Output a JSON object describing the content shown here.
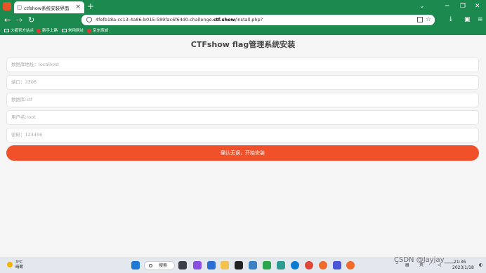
{
  "browser": {
    "tab_title": "ctfshow系统安装界面",
    "url_prefix": "4fefb18a-cc13-4a86-b015-589fac6f64d0.challenge.",
    "url_domain": "ctf.show",
    "url_path": "/install.php?",
    "bookmarks": [
      "火狐官方站点",
      "新手上路",
      "常用网址",
      "京东商城"
    ],
    "accent_color": "#1c8a4f"
  },
  "page": {
    "title": "CTFshow flag管理系统安装",
    "fields": {
      "db_host": "数据库地址：localhost",
      "port": "端口：3306",
      "db_name": "数据库:ctf",
      "username": "用户名:root",
      "password": "密码：123456"
    },
    "submit_label": "确认无误，开始安装",
    "submit_color": "#f0512a"
  },
  "taskbar": {
    "weather_temp": "3°C",
    "weather_desc": "晴朗",
    "search_label": "搜索",
    "ime": "英",
    "time": "21:36",
    "date": "2023/1/18"
  },
  "watermark": "CSDN @Jayjay___"
}
